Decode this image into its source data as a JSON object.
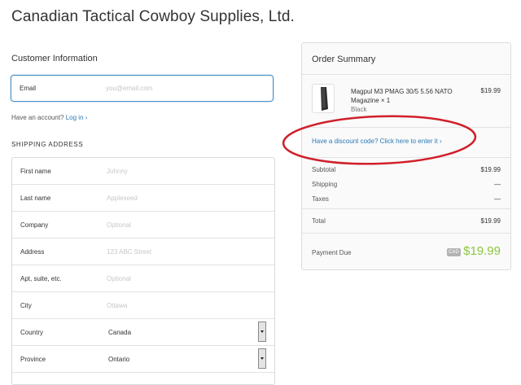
{
  "store": {
    "title": "Canadian Tactical Cowboy Supplies, Ltd."
  },
  "customer": {
    "heading": "Customer Information",
    "email_label": "Email",
    "email_placeholder": "you@email.com",
    "account_prompt": "Have an account?",
    "login_link": "Log in"
  },
  "shipping": {
    "heading": "SHIPPING ADDRESS",
    "rows": [
      {
        "label": "First name",
        "placeholder": "Johnny"
      },
      {
        "label": "Last name",
        "placeholder": "Appleseed"
      },
      {
        "label": "Company",
        "placeholder": "Optional"
      },
      {
        "label": "Address",
        "placeholder": "123 ABC Street"
      },
      {
        "label": "Apt, suite, etc.",
        "placeholder": "Optional"
      },
      {
        "label": "City",
        "placeholder": "Ottawa"
      },
      {
        "label": "Country",
        "value": "Canada"
      },
      {
        "label": "Province",
        "value": "Ontario"
      }
    ]
  },
  "order": {
    "heading": "Order Summary",
    "item": {
      "name": "Magpul M3 PMAG 30/5 5.56 NATO Magazine × 1",
      "variant": "Black",
      "price": "$19.99"
    },
    "discount_link": "Have a discount code? Click here to enter it",
    "subtotal_label": "Subtotal",
    "subtotal_value": "$19.99",
    "shipping_label": "Shipping",
    "shipping_value": "—",
    "taxes_label": "Taxes",
    "taxes_value": "—",
    "total_label": "Total",
    "total_value": "$19.99",
    "due_label": "Payment Due",
    "currency": "CAD",
    "due_value": "$19.99"
  },
  "colors": {
    "accent_link": "#2a7ab6",
    "due_green": "#8cc63f",
    "annotation_red": "#d0202a"
  }
}
